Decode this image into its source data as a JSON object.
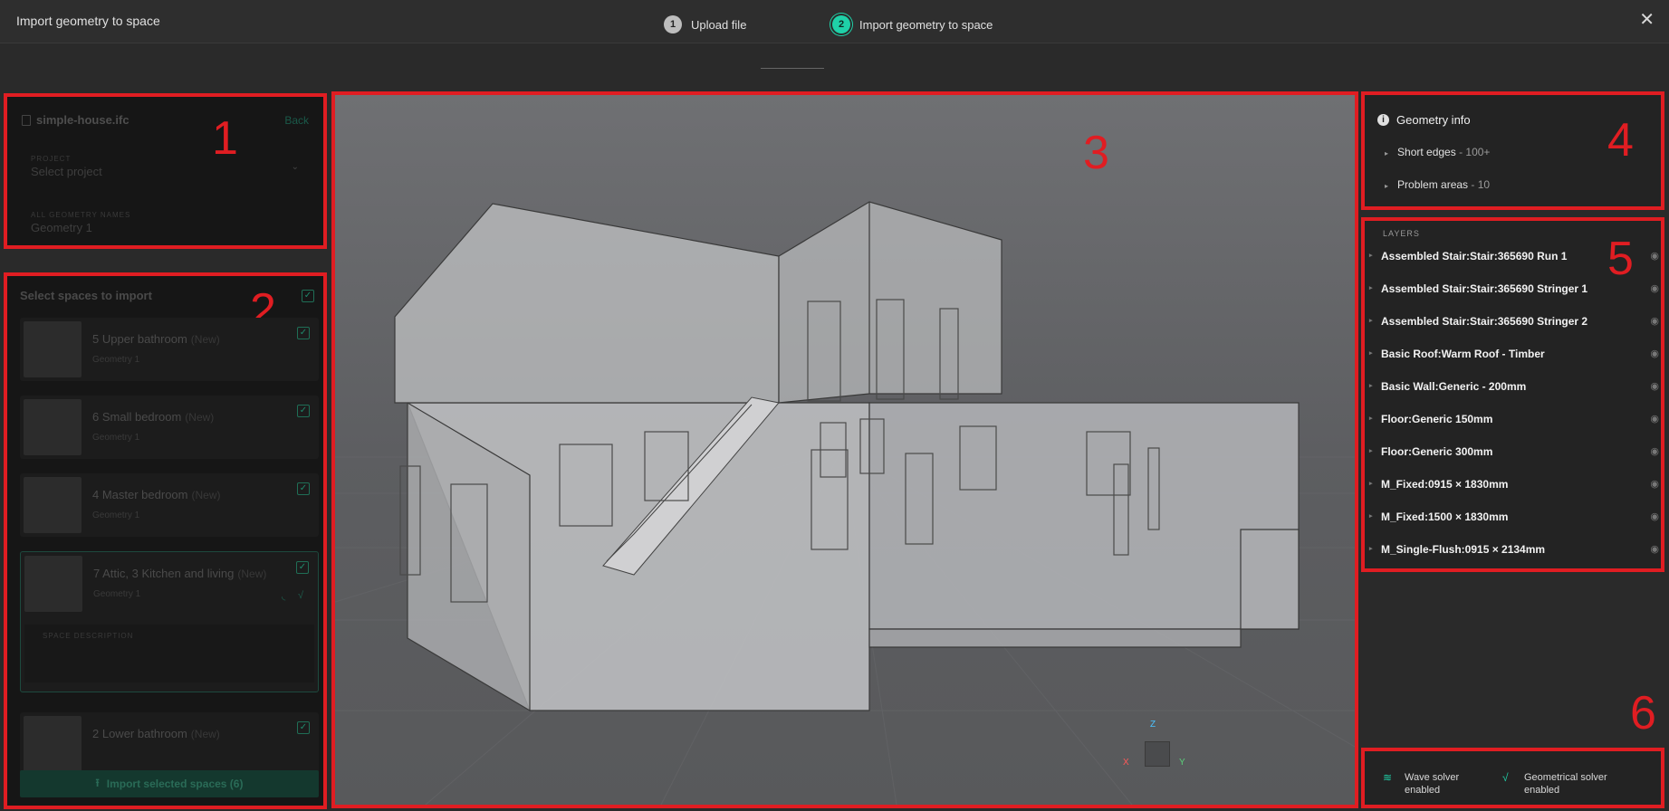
{
  "window": {
    "title": "Import geometry to space",
    "close_icon": "close-icon"
  },
  "stepper": {
    "steps": [
      {
        "number": "1",
        "label": "Upload file"
      },
      {
        "number": "2",
        "label": "Import geometry to space"
      }
    ]
  },
  "annotations": [
    "1",
    "2",
    "3",
    "4",
    "5",
    "6"
  ],
  "file_panel": {
    "file_name": "simple-house.ifc",
    "back_label": "Back",
    "project_label": "PROJECT",
    "project_value": "Select project",
    "geometry_names_label": "ALL GEOMETRY NAMES",
    "geometry_names_value": "Geometry 1"
  },
  "spaces_panel": {
    "header": "Select spaces to import",
    "spaces": [
      {
        "name": "5 Upper bathroom",
        "badge": "(New)",
        "geometry": "Geometry 1"
      },
      {
        "name": "6 Small bedroom",
        "badge": "(New)",
        "geometry": "Geometry 1"
      },
      {
        "name": "4 Master bedroom",
        "badge": "(New)",
        "geometry": "Geometry 1"
      },
      {
        "name": "7 Attic, 3 Kitchen and living",
        "badge": "(New)",
        "geometry": "Geometry 1"
      },
      {
        "name": "2 Lower bathroom",
        "badge": "(New)",
        "geometry": ""
      }
    ],
    "space_description_label": "SPACE DESCRIPTION",
    "import_button": "Import selected spaces (6)"
  },
  "viewport": {
    "axis_x": "X",
    "axis_y": "Y",
    "axis_z": "Z"
  },
  "geometry_info": {
    "title": "Geometry info",
    "rows": [
      {
        "label": "Short edges",
        "value": " - 100+"
      },
      {
        "label": "Problem areas",
        "value": " - 10"
      }
    ]
  },
  "layers": {
    "header": "LAYERS",
    "items": [
      "Assembled Stair:Stair:365690 Run 1",
      "Assembled Stair:Stair:365690 Stringer 1",
      "Assembled Stair:Stair:365690 Stringer 2",
      "Basic Roof:Warm Roof - Timber",
      "Basic Wall:Generic - 200mm",
      "Floor:Generic 150mm",
      "Floor:Generic 300mm",
      "M_Fixed:0915 × 1830mm",
      "M_Fixed:1500 × 1830mm",
      "M_Single-Flush:0915 × 2134mm"
    ]
  },
  "solvers": {
    "wave": {
      "line1": "Wave solver",
      "line2": "enabled"
    },
    "geometrical": {
      "line1": "Geometrical solver",
      "line2": "enabled"
    }
  },
  "colors": {
    "accent": "#1fd1a8",
    "annotation_red": "#e01d22",
    "background": "#2a2a2a"
  }
}
